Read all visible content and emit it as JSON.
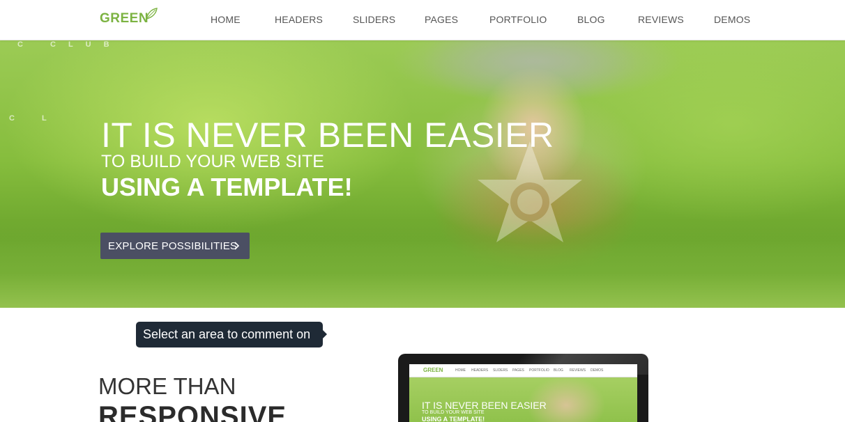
{
  "header": {
    "logo_text": "GREEN",
    "nav": [
      "HOME",
      "HEADERS",
      "SLIDERS",
      "PAGES",
      "PORTFOLIO",
      "BLOG",
      "REVIEWS",
      "DEMOS"
    ]
  },
  "hero": {
    "title": "IT IS NEVER BEEN EASIER",
    "subtitle": "TO BUILD YOUR WEB SITE",
    "emphasis": "USING A TEMPLATE!",
    "button_label": "EXPLORE POSSIBILITIES",
    "bg_letters_top": "C   CLUB",
    "bg_letters_mid": "C L"
  },
  "tooltip": {
    "text": "Select an area to comment on"
  },
  "features": {
    "line1": "MORE THAN",
    "line2": "RESPONSIVE"
  },
  "device_preview": {
    "logo_text": "GREEN",
    "nav": [
      "HOME",
      "HEADERS",
      "SLIDERS",
      "PAGES",
      "PORTFOLIO",
      "BLOG",
      "REVIEWS",
      "DEMOS"
    ],
    "title": "IT IS NEVER BEEN EASIER",
    "subtitle": "TO BUILD YOUR WEB SITE",
    "emphasis": "USING A TEMPLATE!"
  },
  "colors": {
    "brand_green": "#7cb342",
    "button_bg": "#4b4f63",
    "tooltip_bg": "#1f2a36"
  }
}
